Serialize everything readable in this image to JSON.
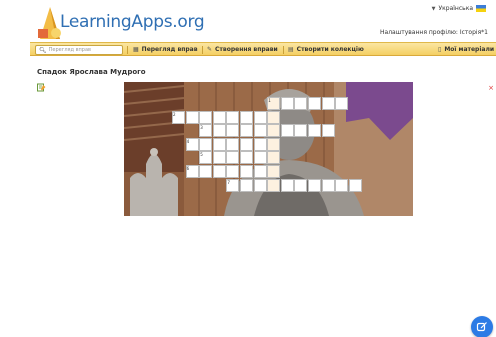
{
  "header": {
    "logo_text": "LearningApps.org",
    "language": "Українська",
    "profile_settings": "Налаштування профілю: Історія*1"
  },
  "nav": {
    "search_placeholder": "Перегляд вправ",
    "items": [
      {
        "label": "Перегляд вправ",
        "icon": "grid-icon"
      },
      {
        "label": "Створення вправи",
        "icon": "pencil-icon"
      },
      {
        "label": "Створити колекцію",
        "icon": "collection-icon"
      },
      {
        "label": "Мої матеріали",
        "icon": "folder-icon"
      }
    ]
  },
  "page": {
    "title": "Спадок Ярослава Мудрого"
  },
  "crossword": {
    "numbers": [
      "1",
      "2",
      "3",
      "4",
      "5",
      "6",
      "7"
    ]
  },
  "colors": {
    "brand": "#2f6fb3",
    "navbar": "#f4cf63",
    "fab": "#2c7be5"
  }
}
